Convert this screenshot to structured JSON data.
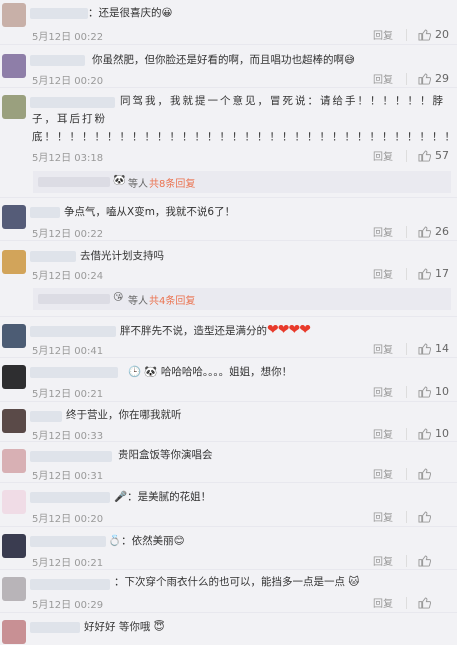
{
  "reply_label": "回复",
  "comments": [
    {
      "text": "：还是很喜庆的😀",
      "time": "5月12日 00:22",
      "likes": "20"
    },
    {
      "text": "你虽然肥，但你脸还是好看的啊，而且唱功也超棒的啊😅",
      "time": "5月12日 00:20",
      "likes": "29"
    },
    {
      "text": "同驾我，我就提一个意见，冒死说：请给手！！！！！！脖子，耳后打粉底！！！！！！！！！！！！！！！！！！！！！！！！！！！！！！！！！",
      "time": "5月12日 03:18",
      "likes": "57"
    },
    {
      "text": "争点气，嗑从X变m，我就不说6了！",
      "time": "5月12日 00:22",
      "likes": "26"
    },
    {
      "text": "去借光计划支持吗",
      "time": "5月12日 00:24",
      "likes": "17"
    },
    {
      "text": "胖不胖先不说，造型还是满分的",
      "hearts": "❤❤❤❤",
      "time": "5月12日 00:41",
      "likes": "14"
    },
    {
      "text": "哈哈哈哈。。。。姐姐，想你！",
      "time": "5月12日 00:21",
      "likes": "10"
    },
    {
      "text": "终于营业，你在哪我就听",
      "time": "5月12日 00:33",
      "likes": "10"
    },
    {
      "text": "贵阳盒饭等你演唱会",
      "time": "5月12日 00:31",
      "likes": ""
    },
    {
      "text": "：是美腻的花姐！",
      "time": "5月12日 00:20",
      "likes": ""
    },
    {
      "text": "：依然美丽😊",
      "time": "5月12日 00:21",
      "likes": ""
    },
    {
      "text": "：下次穿个雨衣什么的也可以，能挡多一点是一点 🐱",
      "time": "5月12日 00:29",
      "likes": ""
    },
    {
      "text": "好好好 等你哦",
      "time": "",
      "likes": ""
    }
  ],
  "subreplies": [
    {
      "people": "等人",
      "link": "共8条回复"
    },
    {
      "people": "等人",
      "link": "共4条回复"
    }
  ]
}
